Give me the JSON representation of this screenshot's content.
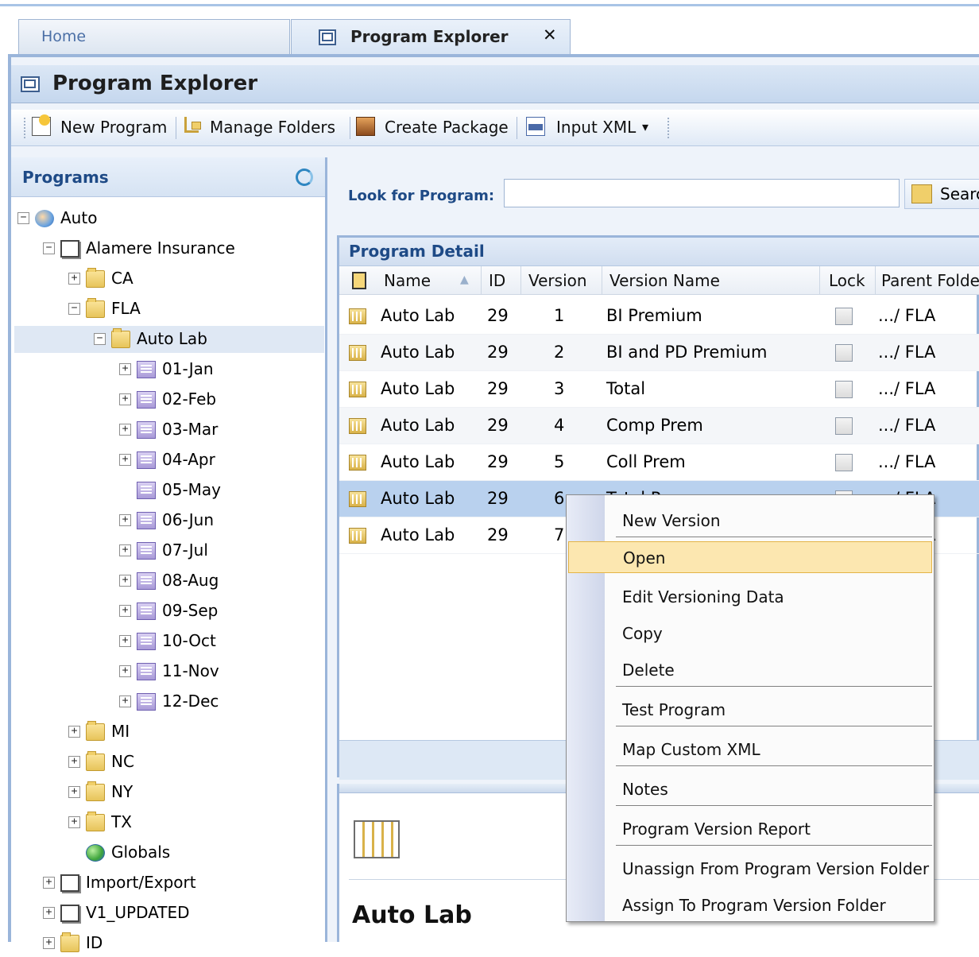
{
  "tabs": {
    "home": "Home",
    "active": "Program Explorer",
    "close": "✕"
  },
  "title": "Program Explorer",
  "toolbar": {
    "new_program": "New Program",
    "manage_folders": "Manage Folders",
    "create_package": "Create Package",
    "input_xml": "Input XML",
    "dropdown": "▾"
  },
  "left_panel": {
    "header": "Programs",
    "tree": [
      {
        "label": "Auto",
        "toggle": "−",
        "icon": "users-icon"
      },
      {
        "label": "Alamere Insurance",
        "toggle": "−",
        "icon": "document-icon"
      },
      {
        "label": "CA",
        "toggle": "+",
        "icon": "folder-icon"
      },
      {
        "label": "FLA",
        "toggle": "−",
        "icon": "folder-icon"
      },
      {
        "label": "Auto Lab",
        "toggle": "−",
        "icon": "folder-icon"
      },
      {
        "label": "01-Jan",
        "toggle": "+",
        "icon": "version-folder-icon"
      },
      {
        "label": "02-Feb",
        "toggle": "+",
        "icon": "version-folder-icon"
      },
      {
        "label": "03-Mar",
        "toggle": "+",
        "icon": "version-folder-icon"
      },
      {
        "label": "04-Apr",
        "toggle": "+",
        "icon": "version-folder-icon"
      },
      {
        "label": "05-May",
        "toggle": "",
        "icon": "version-folder-icon"
      },
      {
        "label": "06-Jun",
        "toggle": "+",
        "icon": "version-folder-icon"
      },
      {
        "label": "07-Jul",
        "toggle": "+",
        "icon": "version-folder-icon"
      },
      {
        "label": "08-Aug",
        "toggle": "+",
        "icon": "version-folder-icon"
      },
      {
        "label": "09-Sep",
        "toggle": "+",
        "icon": "version-folder-icon"
      },
      {
        "label": "10-Oct",
        "toggle": "+",
        "icon": "version-folder-icon"
      },
      {
        "label": "11-Nov",
        "toggle": "+",
        "icon": "version-folder-icon"
      },
      {
        "label": "12-Dec",
        "toggle": "+",
        "icon": "version-folder-icon"
      },
      {
        "label": "MI",
        "toggle": "+",
        "icon": "folder-icon"
      },
      {
        "label": "NC",
        "toggle": "+",
        "icon": "folder-icon"
      },
      {
        "label": "NY",
        "toggle": "+",
        "icon": "folder-icon"
      },
      {
        "label": "TX",
        "toggle": "+",
        "icon": "folder-icon"
      },
      {
        "label": "Globals",
        "toggle": "",
        "icon": "globe-icon"
      },
      {
        "label": "Import/Export",
        "toggle": "+",
        "icon": "document-icon"
      },
      {
        "label": "V1_UPDATED",
        "toggle": "+",
        "icon": "document-icon"
      },
      {
        "label": "ID",
        "toggle": "+",
        "icon": "folder-icon"
      }
    ]
  },
  "search": {
    "label": "Look for Program:",
    "value": "",
    "button": "Search"
  },
  "detail": {
    "header": "Program Detail",
    "columns": [
      "Name",
      "ID",
      "Version",
      "Version Name",
      "Lock",
      "Parent Folder"
    ],
    "rows": [
      {
        "name": "Auto Lab",
        "id": "29",
        "version": "1",
        "version_name": "BI Premium",
        "parent": ".../ FLA"
      },
      {
        "name": "Auto Lab",
        "id": "29",
        "version": "2",
        "version_name": "BI and PD Premium",
        "parent": ".../ FLA"
      },
      {
        "name": "Auto Lab",
        "id": "29",
        "version": "3",
        "version_name": "Total",
        "parent": ".../ FLA"
      },
      {
        "name": "Auto Lab",
        "id": "29",
        "version": "4",
        "version_name": "Comp Prem",
        "parent": ".../ FLA"
      },
      {
        "name": "Auto Lab",
        "id": "29",
        "version": "5",
        "version_name": "Coll Prem",
        "parent": ".../ FLA"
      },
      {
        "name": "Auto Lab",
        "id": "29",
        "version": "6",
        "version_name": "Total Prem",
        "parent": ".../ FLA"
      },
      {
        "name": "Auto Lab",
        "id": "29",
        "version": "7",
        "version_name": "",
        "parent": ".../ FLA"
      }
    ]
  },
  "bottom": {
    "title": "Auto Lab"
  },
  "context_menu": {
    "items": [
      "New Version",
      "Open",
      "Edit Versioning Data",
      "Copy",
      "Delete",
      "Test Program",
      "Map Custom XML",
      "Notes",
      "Program Version Report",
      "Unassign From Program Version Folder",
      "Assign To Program Version Folder"
    ],
    "highlighted_index": 1
  },
  "colors": {
    "accent_blue": "#1e4a86",
    "frame_border": "#9ab5da",
    "selected_row": "#b9d1ee",
    "menu_highlight": "#fce7b0"
  }
}
